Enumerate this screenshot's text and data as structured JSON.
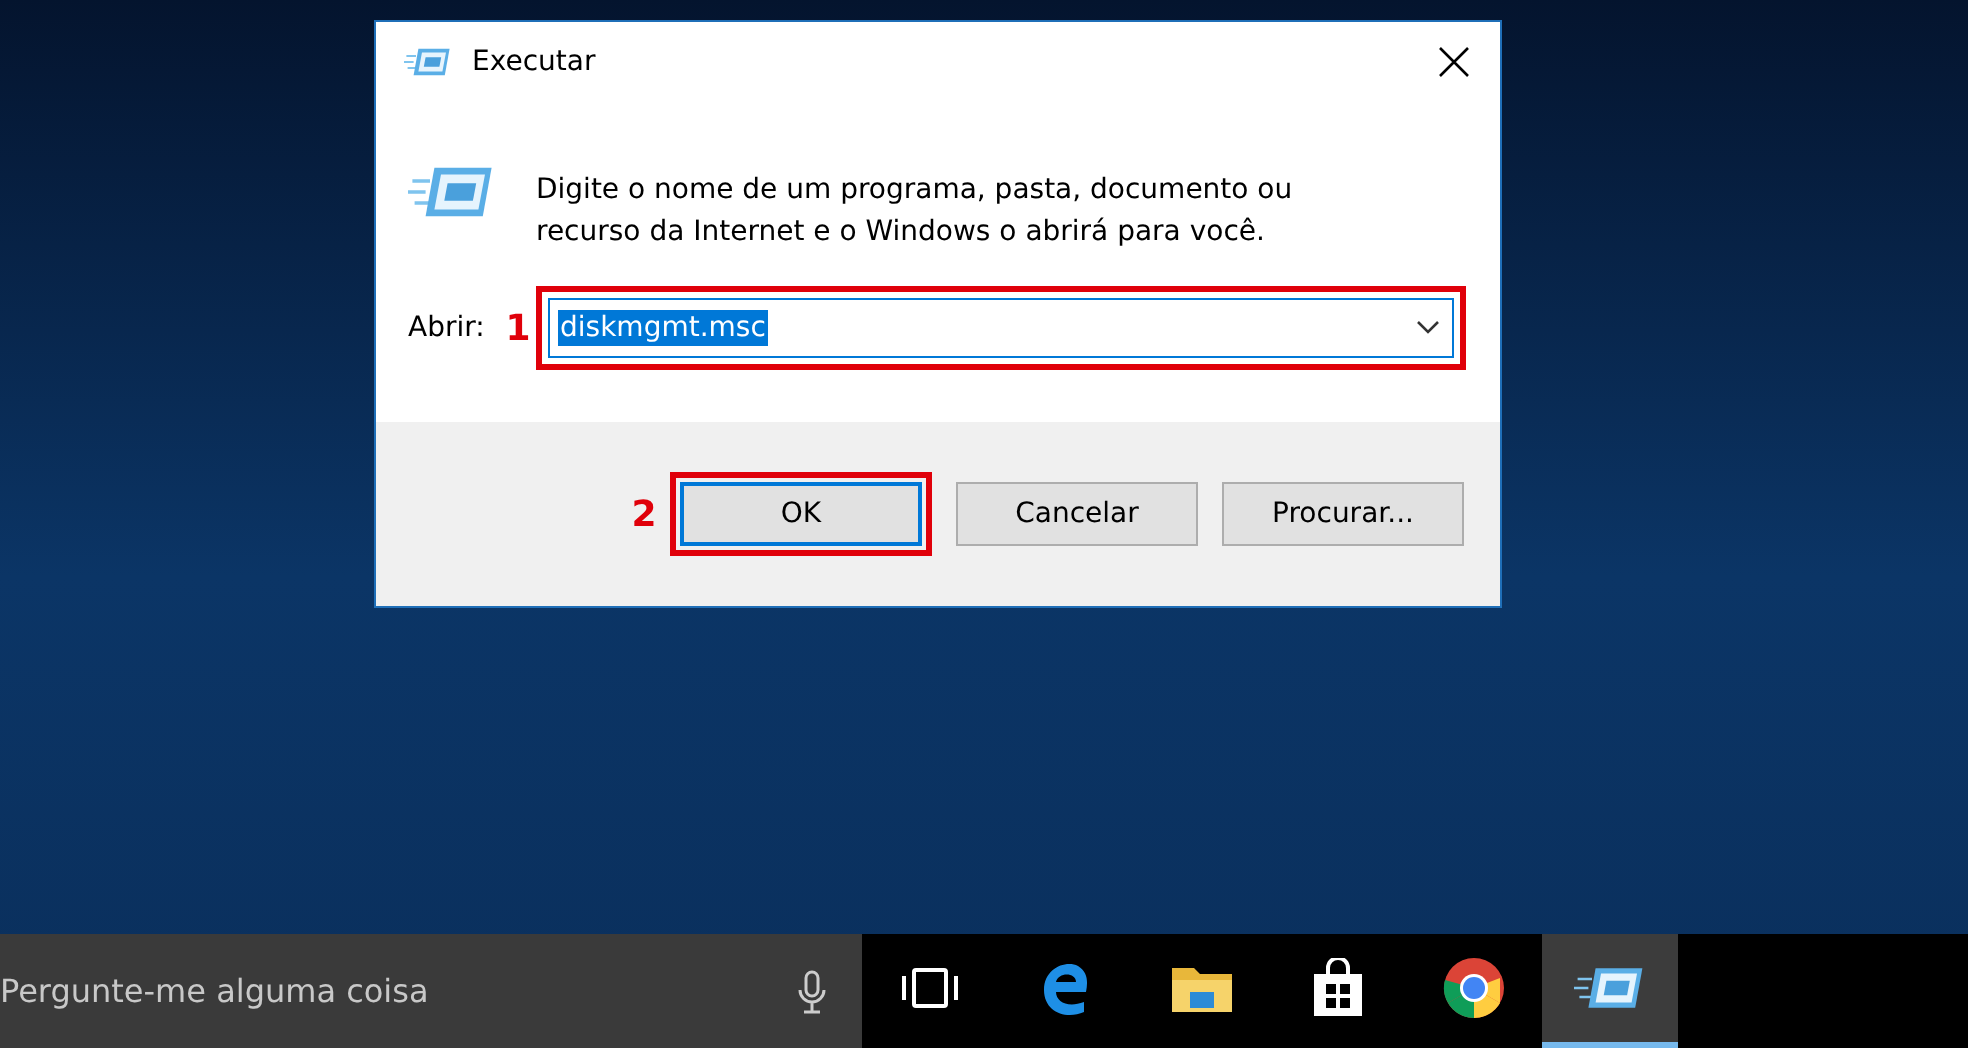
{
  "window": {
    "title": "Executar",
    "description": "Digite o nome de um programa, pasta, documento ou recurso da Internet e o Windows o abrirá para você.",
    "open_label": "Abrir:",
    "open_value": "diskmgmt.msc",
    "buttons": [
      {
        "label": "OK",
        "default": true
      },
      {
        "label": "Cancelar",
        "default": false
      },
      {
        "label": "Procurar...",
        "default": false
      }
    ]
  },
  "annotations": [
    {
      "number": "1"
    },
    {
      "number": "2"
    }
  ],
  "taskbar": {
    "search": {
      "placeholder": "Pergunte-me alguma coisa"
    },
    "apps": [
      {
        "kind": "taskview",
        "active": false
      },
      {
        "kind": "browser",
        "active": false
      },
      {
        "kind": "folder",
        "active": false
      },
      {
        "kind": "store",
        "active": false
      },
      {
        "kind": "chrome",
        "active": false
      },
      {
        "kind": "run",
        "active": true
      }
    ]
  }
}
